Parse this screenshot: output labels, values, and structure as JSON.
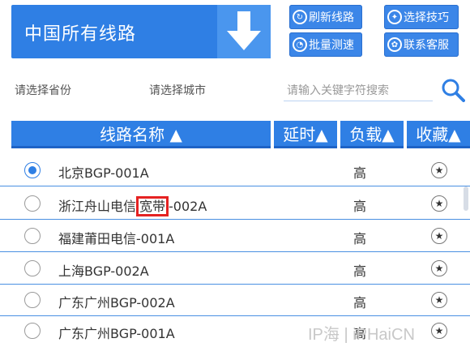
{
  "header": {
    "title": "中国所有线路",
    "buttons": {
      "refresh": "刷新线路",
      "tips": "选择技巧",
      "batch_test": "批量测速",
      "support": "联系客服"
    }
  },
  "filters": {
    "province": "请选择省份",
    "city": "请选择城市",
    "search_placeholder": "请输入关键字符搜索"
  },
  "table": {
    "columns": [
      "线路名称 ▲",
      "延时▲",
      "负载▲",
      "收藏▲"
    ],
    "rows": [
      {
        "name": "北京BGP-001A",
        "load": "高",
        "selected": true
      },
      {
        "name_a": "浙江舟山电信",
        "name_b": "宽带",
        "name_c": "-002A",
        "load": "高",
        "selected": false
      },
      {
        "name": "福建莆田电信-001A",
        "load": "高",
        "selected": false
      },
      {
        "name": "上海BGP-002A",
        "load": "高",
        "selected": false
      },
      {
        "name": "广东广州BGP-002A",
        "load": "高",
        "selected": false
      },
      {
        "name": "广东广州BGP-001A",
        "load": "高",
        "selected": false
      }
    ]
  },
  "watermark": "IP海 | iPHaiCN",
  "colors": {
    "accent": "#2f7fe4",
    "highlight": "#e52222"
  }
}
